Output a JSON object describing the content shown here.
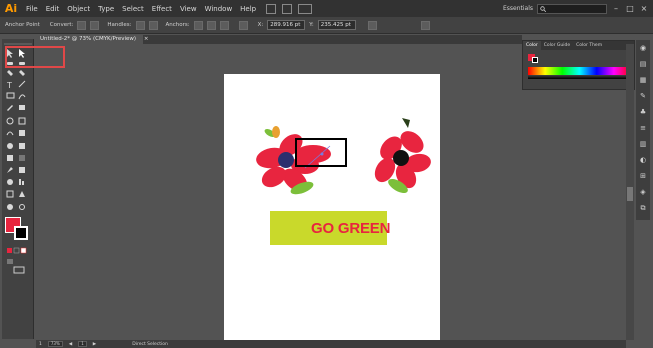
{
  "app": {
    "logo": "Ai",
    "menus": [
      "File",
      "Edit",
      "Object",
      "Type",
      "Select",
      "Effect",
      "View",
      "Window",
      "Help"
    ],
    "workspace": "Essentials",
    "search_icon": "search-icon"
  },
  "controlbar": {
    "anchor_point_label": "Anchor Point",
    "convert_label": "Convert:",
    "handles_label": "Handles:",
    "anchors_label": "Anchors:",
    "x_label": "X:",
    "x_value": "289.916 pt",
    "y_label": "Y:",
    "y_value": "235.425 pt"
  },
  "document": {
    "tab_title": "Untitled-2* @ 73% (CMYK/Preview)",
    "tab_close": "×"
  },
  "color_panel": {
    "tabs": [
      "Color",
      "Color Guide",
      "Color Them"
    ]
  },
  "artwork": {
    "banner_text": "GO GREEN",
    "banner_color": "#c9d92b",
    "accent": "#e8253f"
  },
  "status": {
    "page_number": "1",
    "zoom": "73%",
    "selection_tool": "Direct Selection"
  },
  "colors": {
    "menubar": "#323232",
    "panel": "#424242",
    "canvas": "#535353",
    "highlight": "#e04848"
  }
}
